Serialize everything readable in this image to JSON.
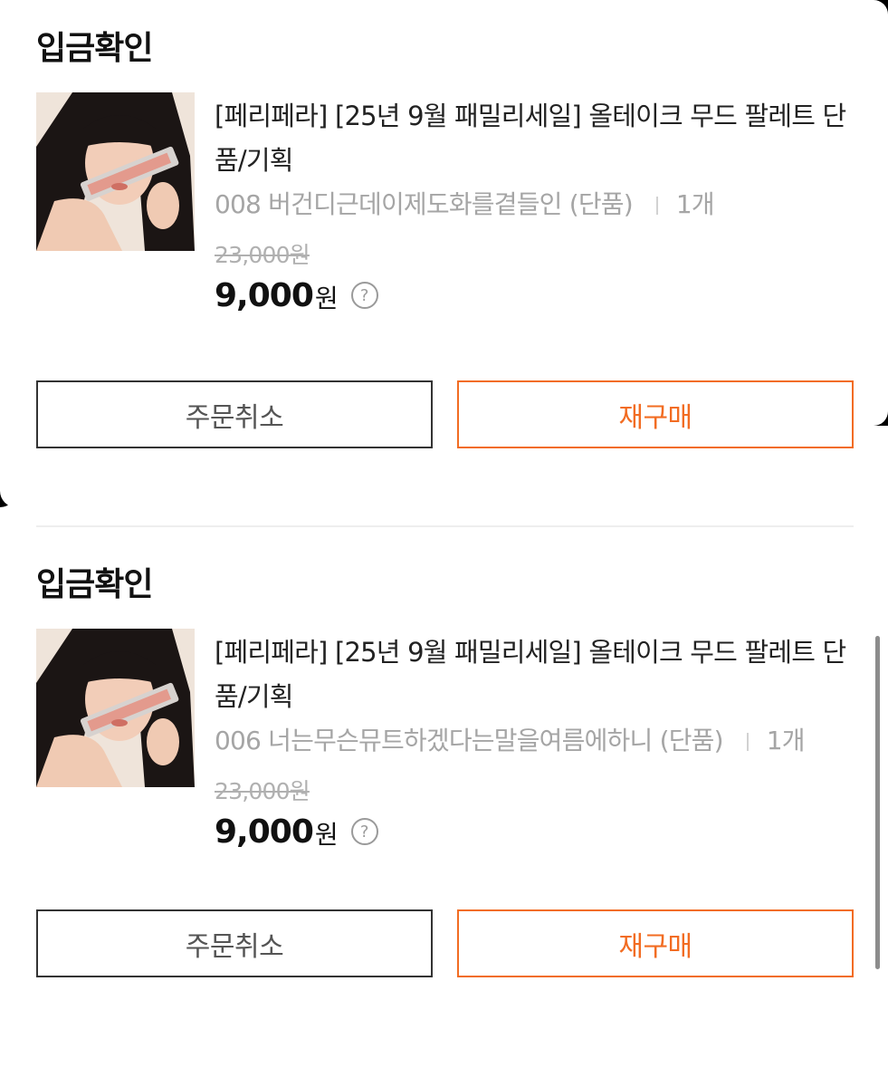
{
  "orders": [
    {
      "status": "입금확인",
      "product_name": "[페리페라] [25년 9월 패밀리세일] 올테이크 무드 팔레트 단품/기획",
      "option": "008 버건디근데이제도화를곁들인 (단품)",
      "quantity": "1개",
      "original_price": "23,000원",
      "price": "9,000",
      "currency": "원",
      "help_symbol": "?",
      "cancel_label": "주문취소",
      "rebuy_label": "재구매"
    },
    {
      "status": "입금확인",
      "product_name": "[페리페라] [25년 9월 패밀리세일] 올테이크 무드 팔레트 단품/기획",
      "option": "006 너는무슨뮤트하겠다는말을여름에하니 (단품)",
      "quantity": "1개",
      "original_price": "23,000원",
      "price": "9,000",
      "currency": "원",
      "help_symbol": "?",
      "cancel_label": "주문취소",
      "rebuy_label": "재구매"
    }
  ],
  "colors": {
    "accent": "#f26c22",
    "text": "#111111",
    "muted": "#a5a5a5",
    "cancel_border": "#333333"
  },
  "icons": {
    "help": "question-circle-icon"
  }
}
